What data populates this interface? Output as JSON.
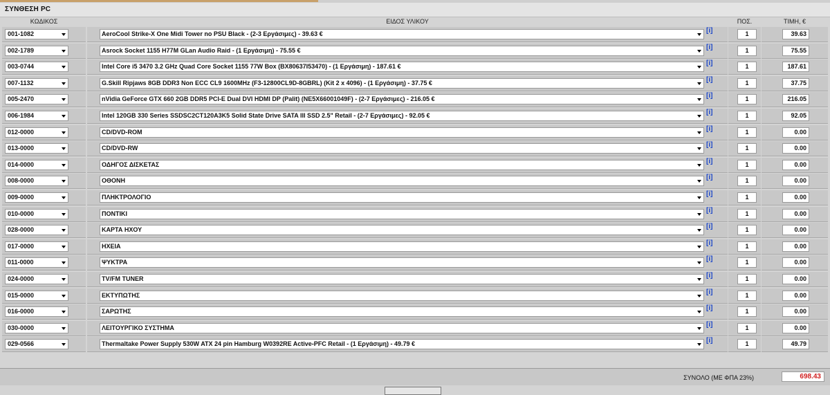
{
  "title": "ΣΥΝΘΕΣΗ PC",
  "headers": {
    "code": "ΚΩΔΙΚΟΣ",
    "item": "ΕΙΔΟΣ ΥΛΙΚΟΥ",
    "qty": "ΠΟΣ.",
    "price": "ΤΙΜΗ, €"
  },
  "info_label": "[i]",
  "rows": [
    {
      "code": "001-1082",
      "desc": "AeroCool Strike-X One Midi Tower no PSU Black - (2-3 Εργάσιμες) - 39.63 €",
      "qty": "1",
      "price": "39.63"
    },
    {
      "code": "002-1789",
      "desc": "Asrock Socket 1155 H77M GLan Audio Raid - (1 Εργάσιμη) - 75.55 €",
      "qty": "1",
      "price": "75.55"
    },
    {
      "code": "003-0744",
      "desc": "Intel Core i5 3470 3.2 GHz Quad Core Socket 1155 77W Box (BX80637I53470) - (1 Εργάσιμη) - 187.61 €",
      "qty": "1",
      "price": "187.61"
    },
    {
      "code": "007-1132",
      "desc": "G.Skill Ripjaws 8GB DDR3 Non ECC CL9 1600MHz (F3-12800CL9D-8GBRL) (Kit 2 x 4096) - (1 Εργάσιμη) - 37.75 €",
      "qty": "1",
      "price": "37.75"
    },
    {
      "code": "005-2470",
      "desc": "nVidia GeForce GTX 660 2GB DDR5 PCI-E Dual DVI HDMI DP (Palit) (NE5X66001049F) - (2-7 Εργάσιμες) - 216.05 €",
      "qty": "1",
      "price": "216.05"
    },
    {
      "code": "006-1984",
      "desc": "Intel 120GB 330 Series SSDSC2CT120A3K5 Solid State Drive SATA III SSD 2.5\" Retail - (2-7 Εργάσιμες) - 92.05 €",
      "qty": "1",
      "price": "92.05"
    },
    {
      "code": "012-0000",
      "desc": "CD/DVD-ROM",
      "qty": "1",
      "price": "0.00"
    },
    {
      "code": "013-0000",
      "desc": "CD/DVD-RW",
      "qty": "1",
      "price": "0.00"
    },
    {
      "code": "014-0000",
      "desc": "ΟΔΗΓΟΣ ΔΙΣΚΕΤΑΣ",
      "qty": "1",
      "price": "0.00"
    },
    {
      "code": "008-0000",
      "desc": "ΟΘΟΝΗ",
      "qty": "1",
      "price": "0.00"
    },
    {
      "code": "009-0000",
      "desc": "ΠΛΗΚΤΡΟΛΟΓΙΟ",
      "qty": "1",
      "price": "0.00"
    },
    {
      "code": "010-0000",
      "desc": "ΠΟΝΤΙΚΙ",
      "qty": "1",
      "price": "0.00"
    },
    {
      "code": "028-0000",
      "desc": "ΚΑΡΤΑ ΗΧΟΥ",
      "qty": "1",
      "price": "0.00"
    },
    {
      "code": "017-0000",
      "desc": "ΗΧΕΙΑ",
      "qty": "1",
      "price": "0.00"
    },
    {
      "code": "011-0000",
      "desc": "ΨΥΚΤΡΑ",
      "qty": "1",
      "price": "0.00"
    },
    {
      "code": "024-0000",
      "desc": "TV/FM TUNER",
      "qty": "1",
      "price": "0.00"
    },
    {
      "code": "015-0000",
      "desc": "ΕΚΤΥΠΩΤΗΣ",
      "qty": "1",
      "price": "0.00"
    },
    {
      "code": "016-0000",
      "desc": "ΣΑΡΩΤΗΣ",
      "qty": "1",
      "price": "0.00"
    },
    {
      "code": "030-0000",
      "desc": "ΛΕΙΤΟΥΡΓΙΚΟ ΣΥΣΤΗΜΑ",
      "qty": "1",
      "price": "0.00"
    },
    {
      "code": "029-0566",
      "desc": "Thermaltake Power Supply 530W ATX 24 pin Hamburg W0392RE Active-PFC Retail - (1 Εργάσιμη) - 49.79 €",
      "qty": "1",
      "price": "49.79"
    }
  ],
  "footer": {
    "total_label": "ΣΥΝΟΛΟ (ΜΕ ΦΠΑ 23%)",
    "total_value": "698.43"
  },
  "bottom_button_label": "",
  "colors": {
    "accent": "#c8a06a",
    "info": "#1c46c8",
    "total": "#d02020"
  }
}
